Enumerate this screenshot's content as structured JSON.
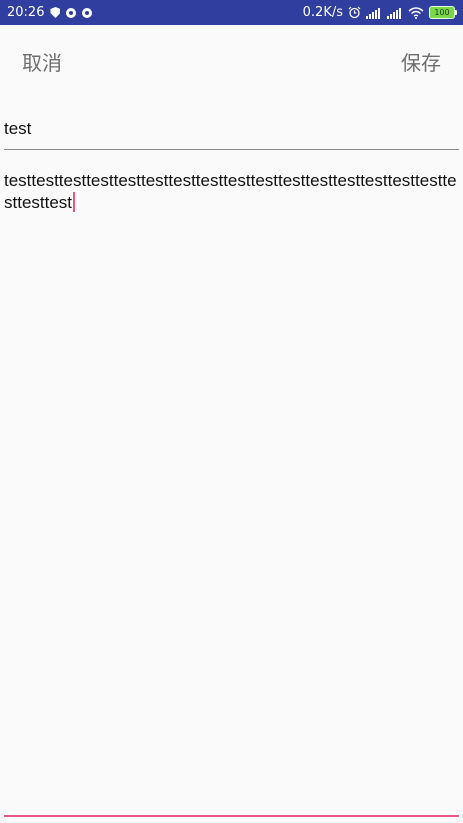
{
  "status_bar": {
    "time": "20:26",
    "net_speed": "0.2K/s",
    "battery_level": "100",
    "icons_left": [
      "shield-icon",
      "record-icon",
      "record-icon"
    ],
    "icons_right": [
      "alarm-icon",
      "signal-icon",
      "signal-icon",
      "wifi-icon",
      "battery-icon"
    ]
  },
  "toolbar": {
    "cancel_label": "取消",
    "save_label": "保存"
  },
  "editor": {
    "title_value": "test",
    "body_value": "testtesttesttesttesttesttesttesttesttesttesttesttesttesttesttesttesttesttest"
  },
  "colors": {
    "status_bar": "#303f9f",
    "accent": "#e5578a",
    "background": "#fafafa"
  }
}
